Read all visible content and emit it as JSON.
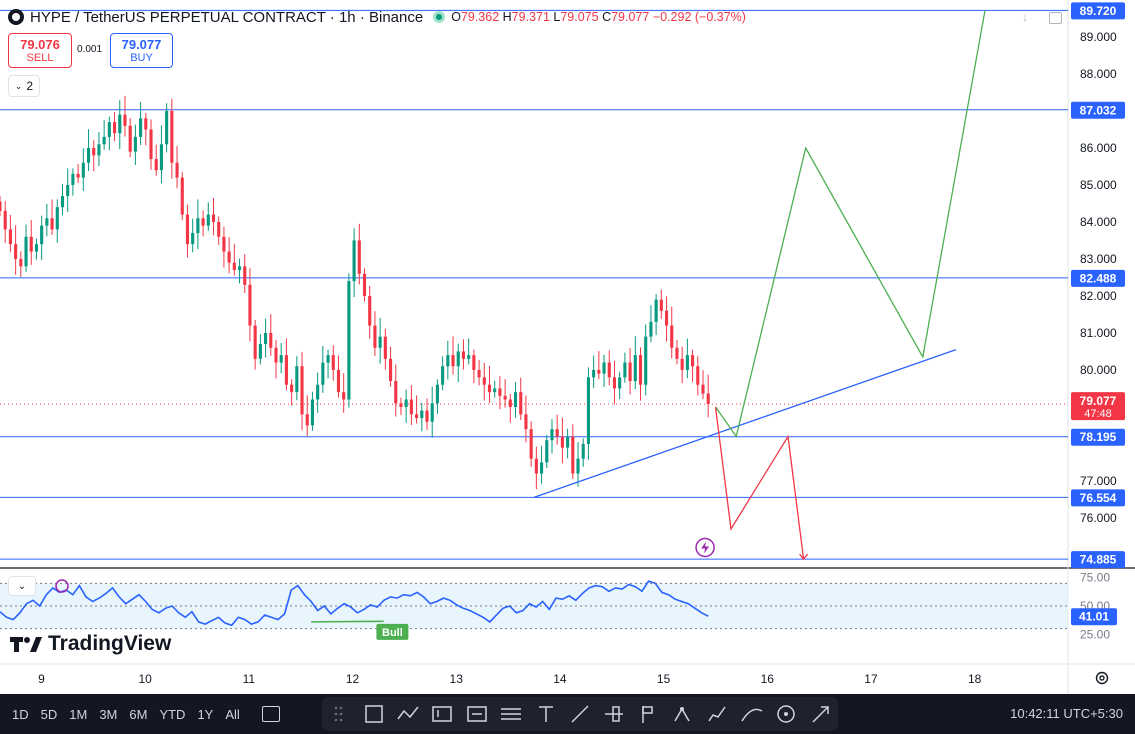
{
  "header": {
    "symbol": "HYPE / TetherUS PERPETUAL CONTRACT · 1h · Binance",
    "ohlc": {
      "o_label": "O",
      "o": "79.362",
      "h_label": "H",
      "h": "79.371",
      "l_label": "L",
      "l": "79.075",
      "c_label": "C",
      "c": "79.077",
      "change": "−0.292 (−0.37%)"
    }
  },
  "trade": {
    "sell_price": "79.076",
    "sell_label": "SELL",
    "spread": "0.001",
    "buy_price": "79.077",
    "buy_label": "BUY"
  },
  "indicator_collapse_count": "2",
  "brand": "TradingView",
  "ranges": [
    "1D",
    "5D",
    "1M",
    "3M",
    "6M",
    "YTD",
    "1Y",
    "All"
  ],
  "clock": "10:42:11 UTC+5:30",
  "colors": {
    "up": "#089981",
    "down": "#f23645",
    "line": "#2962ff",
    "green": "#4caf50",
    "red": "#f23645"
  },
  "chart_data": {
    "type": "candlestick",
    "x_ticks": [
      "9",
      "10",
      "11",
      "12",
      "13",
      "14",
      "15",
      "16",
      "17",
      "18"
    ],
    "x_tick_days": [
      9,
      10,
      11,
      12,
      13,
      14,
      15,
      16,
      17,
      18
    ],
    "xlim_days": [
      8.6,
      18.9
    ],
    "ylim": [
      74.7,
      90.0
    ],
    "y_ticks": [
      "89.000",
      "88.000",
      "86.000",
      "85.000",
      "84.000",
      "83.000",
      "82.000",
      "81.000",
      "80.000",
      "77.000",
      "76.000"
    ],
    "y_tick_values": [
      89,
      88,
      86,
      85,
      84,
      83,
      82,
      81,
      80,
      77,
      76
    ],
    "last_price": "79.077",
    "countdown": "47:48",
    "horizontal_levels": [
      {
        "value": 89.72,
        "label": "89.720"
      },
      {
        "value": 87.032,
        "label": "87.032"
      },
      {
        "value": 82.488,
        "label": "82.488"
      },
      {
        "value": 78.195,
        "label": "78.195"
      },
      {
        "value": 76.554,
        "label": "76.554"
      },
      {
        "value": 74.885,
        "label": "74.885"
      }
    ],
    "trendline": {
      "from": [
        13.75,
        76.554
      ],
      "to": [
        17.82,
        80.55
      ]
    },
    "bull_projection": [
      [
        15.5,
        79.0
      ],
      [
        15.7,
        78.2
      ],
      [
        16.37,
        86.0
      ],
      [
        17.5,
        80.35
      ],
      [
        18.1,
        89.72
      ]
    ],
    "bear_projection": [
      [
        15.5,
        79.0
      ],
      [
        15.65,
        75.7
      ],
      [
        16.2,
        78.2
      ],
      [
        16.35,
        74.885
      ]
    ],
    "ohlc_closes": [
      84.3,
      83.8,
      83.4,
      83.0,
      82.8,
      83.6,
      83.2,
      83.4,
      83.9,
      84.1,
      83.8,
      84.4,
      84.7,
      85.0,
      85.3,
      85.2,
      85.6,
      86.0,
      85.8,
      86.1,
      86.3,
      86.7,
      86.4,
      86.9,
      86.6,
      85.9,
      86.3,
      86.8,
      86.5,
      85.7,
      85.4,
      86.1,
      87.0,
      85.6,
      85.2,
      84.2,
      83.4,
      83.7,
      84.1,
      83.9,
      84.2,
      84.0,
      83.6,
      83.2,
      82.9,
      82.7,
      82.8,
      82.3,
      81.2,
      80.3,
      80.7,
      81.0,
      80.6,
      80.2,
      80.4,
      79.6,
      79.4,
      80.1,
      78.8,
      78.5,
      79.2,
      79.6,
      80.2,
      80.4,
      80.0,
      79.4,
      79.2,
      82.4,
      83.5,
      82.6,
      82.0,
      81.2,
      80.6,
      80.9,
      80.3,
      79.7,
      79.1,
      79.0,
      79.2,
      78.8,
      78.7,
      78.9,
      78.6,
      79.1,
      79.6,
      80.1,
      80.4,
      80.1,
      80.5,
      80.3,
      80.4,
      80.0,
      79.8,
      79.6,
      79.4,
      79.5,
      79.3,
      79.2,
      79.0,
      79.4,
      78.8,
      78.4,
      77.6,
      77.2,
      77.5,
      78.1,
      78.4,
      78.2,
      77.9,
      78.2,
      77.2,
      77.6,
      78.0,
      79.8,
      80.0,
      79.9,
      80.2,
      79.8,
      79.5,
      79.8,
      80.2,
      79.7,
      80.4,
      79.6,
      80.9,
      81.3,
      81.9,
      81.6,
      81.2,
      80.6,
      80.3,
      80.0,
      80.4,
      80.1,
      79.6,
      79.36,
      79.08
    ],
    "oscillator": {
      "ylim": [
        20,
        80
      ],
      "y_ticks": [
        "75.00",
        "50.00",
        "25.00"
      ],
      "y_tick_values": [
        75,
        50,
        25
      ],
      "current": "41.01",
      "current_value": 41.01,
      "band": [
        30,
        70
      ],
      "divergence_label": "Bull",
      "values": [
        45,
        40,
        38,
        44,
        52,
        55,
        50,
        60,
        66,
        62,
        64,
        60,
        68,
        58,
        54,
        57,
        61,
        66,
        58,
        52,
        56,
        60,
        54,
        47,
        44,
        48,
        50,
        44,
        40,
        45,
        36,
        34,
        37,
        40,
        35,
        33,
        40,
        38,
        34,
        36,
        42,
        40,
        38,
        43,
        64,
        68,
        60,
        54,
        46,
        50,
        43,
        48,
        52,
        49,
        44,
        47,
        51,
        49,
        55,
        58,
        57,
        60,
        59,
        62,
        58,
        52,
        54,
        57,
        55,
        51,
        48,
        46,
        43,
        40,
        36,
        42,
        48,
        50,
        44,
        46,
        52,
        49,
        54,
        47,
        57,
        56,
        59,
        55,
        61,
        66,
        68,
        67,
        63,
        66,
        65,
        69,
        67,
        63,
        72,
        70,
        62,
        60,
        56,
        54,
        52,
        48,
        44,
        41
      ]
    }
  }
}
